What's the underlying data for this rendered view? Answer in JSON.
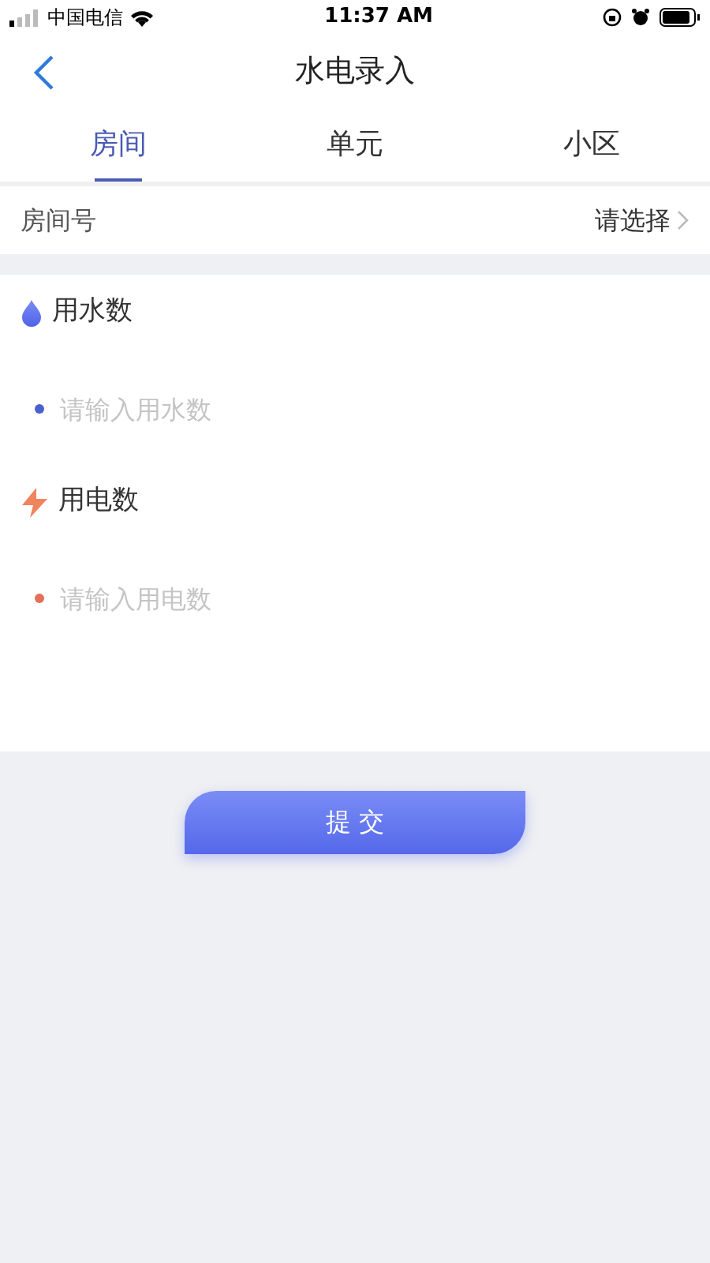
{
  "status_bar": {
    "carrier": "中国电信",
    "time": "11:37 AM"
  },
  "nav": {
    "title": "水电录入"
  },
  "tabs": [
    {
      "label": "房间",
      "selected": true
    },
    {
      "label": "单元",
      "selected": false
    },
    {
      "label": "小区",
      "selected": false
    }
  ],
  "room_row": {
    "label": "房间号",
    "value": "请选择"
  },
  "fields": [
    {
      "kind": "water",
      "label": "用水数",
      "placeholder": "请输入用水数",
      "color": "#4a5fd0"
    },
    {
      "kind": "electricity",
      "label": "用电数",
      "placeholder": "请输入用电数",
      "color": "#e4705a"
    }
  ],
  "submit_button": "提 交"
}
